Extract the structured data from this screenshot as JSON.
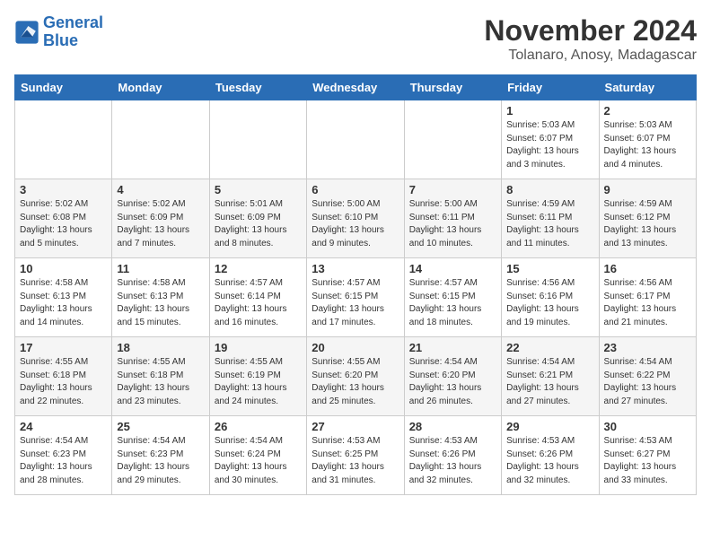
{
  "header": {
    "logo_line1": "General",
    "logo_line2": "Blue",
    "month": "November 2024",
    "location": "Tolanaro, Anosy, Madagascar"
  },
  "days_of_week": [
    "Sunday",
    "Monday",
    "Tuesday",
    "Wednesday",
    "Thursday",
    "Friday",
    "Saturday"
  ],
  "weeks": [
    [
      {
        "day": "",
        "info": ""
      },
      {
        "day": "",
        "info": ""
      },
      {
        "day": "",
        "info": ""
      },
      {
        "day": "",
        "info": ""
      },
      {
        "day": "",
        "info": ""
      },
      {
        "day": "1",
        "info": "Sunrise: 5:03 AM\nSunset: 6:07 PM\nDaylight: 13 hours and 3 minutes."
      },
      {
        "day": "2",
        "info": "Sunrise: 5:03 AM\nSunset: 6:07 PM\nDaylight: 13 hours and 4 minutes."
      }
    ],
    [
      {
        "day": "3",
        "info": "Sunrise: 5:02 AM\nSunset: 6:08 PM\nDaylight: 13 hours and 5 minutes."
      },
      {
        "day": "4",
        "info": "Sunrise: 5:02 AM\nSunset: 6:09 PM\nDaylight: 13 hours and 7 minutes."
      },
      {
        "day": "5",
        "info": "Sunrise: 5:01 AM\nSunset: 6:09 PM\nDaylight: 13 hours and 8 minutes."
      },
      {
        "day": "6",
        "info": "Sunrise: 5:00 AM\nSunset: 6:10 PM\nDaylight: 13 hours and 9 minutes."
      },
      {
        "day": "7",
        "info": "Sunrise: 5:00 AM\nSunset: 6:11 PM\nDaylight: 13 hours and 10 minutes."
      },
      {
        "day": "8",
        "info": "Sunrise: 4:59 AM\nSunset: 6:11 PM\nDaylight: 13 hours and 11 minutes."
      },
      {
        "day": "9",
        "info": "Sunrise: 4:59 AM\nSunset: 6:12 PM\nDaylight: 13 hours and 13 minutes."
      }
    ],
    [
      {
        "day": "10",
        "info": "Sunrise: 4:58 AM\nSunset: 6:13 PM\nDaylight: 13 hours and 14 minutes."
      },
      {
        "day": "11",
        "info": "Sunrise: 4:58 AM\nSunset: 6:13 PM\nDaylight: 13 hours and 15 minutes."
      },
      {
        "day": "12",
        "info": "Sunrise: 4:57 AM\nSunset: 6:14 PM\nDaylight: 13 hours and 16 minutes."
      },
      {
        "day": "13",
        "info": "Sunrise: 4:57 AM\nSunset: 6:15 PM\nDaylight: 13 hours and 17 minutes."
      },
      {
        "day": "14",
        "info": "Sunrise: 4:57 AM\nSunset: 6:15 PM\nDaylight: 13 hours and 18 minutes."
      },
      {
        "day": "15",
        "info": "Sunrise: 4:56 AM\nSunset: 6:16 PM\nDaylight: 13 hours and 19 minutes."
      },
      {
        "day": "16",
        "info": "Sunrise: 4:56 AM\nSunset: 6:17 PM\nDaylight: 13 hours and 21 minutes."
      }
    ],
    [
      {
        "day": "17",
        "info": "Sunrise: 4:55 AM\nSunset: 6:18 PM\nDaylight: 13 hours and 22 minutes."
      },
      {
        "day": "18",
        "info": "Sunrise: 4:55 AM\nSunset: 6:18 PM\nDaylight: 13 hours and 23 minutes."
      },
      {
        "day": "19",
        "info": "Sunrise: 4:55 AM\nSunset: 6:19 PM\nDaylight: 13 hours and 24 minutes."
      },
      {
        "day": "20",
        "info": "Sunrise: 4:55 AM\nSunset: 6:20 PM\nDaylight: 13 hours and 25 minutes."
      },
      {
        "day": "21",
        "info": "Sunrise: 4:54 AM\nSunset: 6:20 PM\nDaylight: 13 hours and 26 minutes."
      },
      {
        "day": "22",
        "info": "Sunrise: 4:54 AM\nSunset: 6:21 PM\nDaylight: 13 hours and 27 minutes."
      },
      {
        "day": "23",
        "info": "Sunrise: 4:54 AM\nSunset: 6:22 PM\nDaylight: 13 hours and 27 minutes."
      }
    ],
    [
      {
        "day": "24",
        "info": "Sunrise: 4:54 AM\nSunset: 6:23 PM\nDaylight: 13 hours and 28 minutes."
      },
      {
        "day": "25",
        "info": "Sunrise: 4:54 AM\nSunset: 6:23 PM\nDaylight: 13 hours and 29 minutes."
      },
      {
        "day": "26",
        "info": "Sunrise: 4:54 AM\nSunset: 6:24 PM\nDaylight: 13 hours and 30 minutes."
      },
      {
        "day": "27",
        "info": "Sunrise: 4:53 AM\nSunset: 6:25 PM\nDaylight: 13 hours and 31 minutes."
      },
      {
        "day": "28",
        "info": "Sunrise: 4:53 AM\nSunset: 6:26 PM\nDaylight: 13 hours and 32 minutes."
      },
      {
        "day": "29",
        "info": "Sunrise: 4:53 AM\nSunset: 6:26 PM\nDaylight: 13 hours and 32 minutes."
      },
      {
        "day": "30",
        "info": "Sunrise: 4:53 AM\nSunset: 6:27 PM\nDaylight: 13 hours and 33 minutes."
      }
    ]
  ]
}
